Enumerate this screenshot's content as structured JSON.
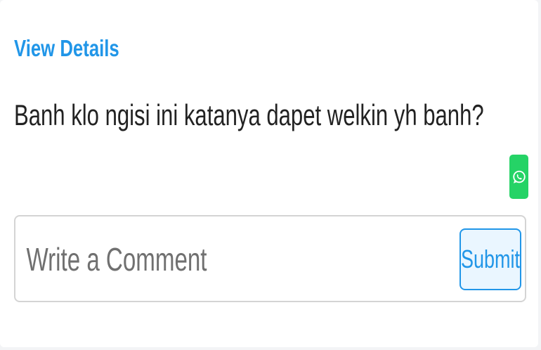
{
  "post": {
    "view_details_label": "View Details",
    "message": "Banh klo ngisi ini katanya dapet welkin yh banh?",
    "share_icon": "whatsapp-icon"
  },
  "comment": {
    "placeholder": "Write a Comment",
    "value": "",
    "submit_label": "Submit"
  },
  "colors": {
    "accent": "#2196e8",
    "whatsapp": "#25d366",
    "submit_bg": "#eaf6ff",
    "text": "#222222"
  }
}
